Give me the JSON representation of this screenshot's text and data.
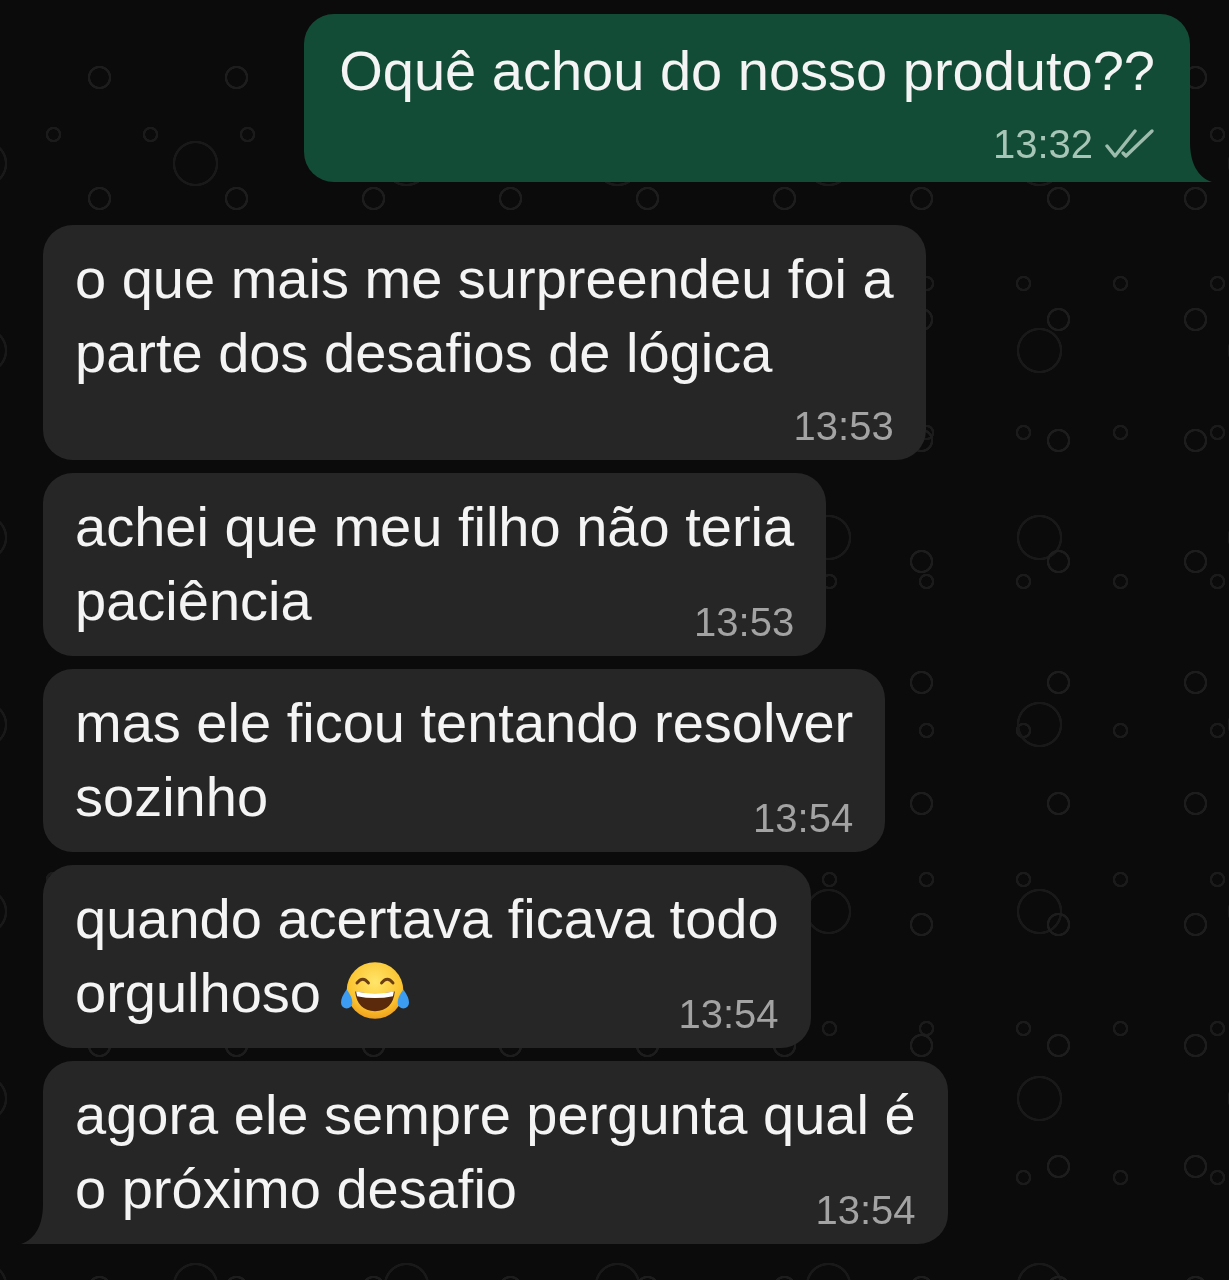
{
  "chat": {
    "messages": [
      {
        "kind": "outgoing",
        "lines": [
          "Oquê achou do nosso produto??"
        ],
        "time": "13:32",
        "read": false,
        "tail": true
      },
      {
        "kind": "incoming",
        "lines": [
          "o que mais me surpreendeu foi a",
          "parte dos desafios de lógica"
        ],
        "time": "13:53",
        "tail": false
      },
      {
        "kind": "incoming",
        "lines": [
          "achei que meu filho não teria",
          "paciência"
        ],
        "time": "13:53",
        "tail": false
      },
      {
        "kind": "incoming",
        "lines": [
          "mas ele ficou tentando resolver",
          "sozinho"
        ],
        "time": "13:54",
        "tail": false
      },
      {
        "kind": "incoming",
        "lines": [
          "quando acertava ficava todo",
          "orgulhoso"
        ],
        "emoji": true,
        "time": "13:54",
        "tail": false
      },
      {
        "kind": "incoming",
        "lines": [
          "agora ele sempre pergunta qual é",
          "o próximo desafio"
        ],
        "time": "13:54",
        "tail": true
      }
    ]
  }
}
